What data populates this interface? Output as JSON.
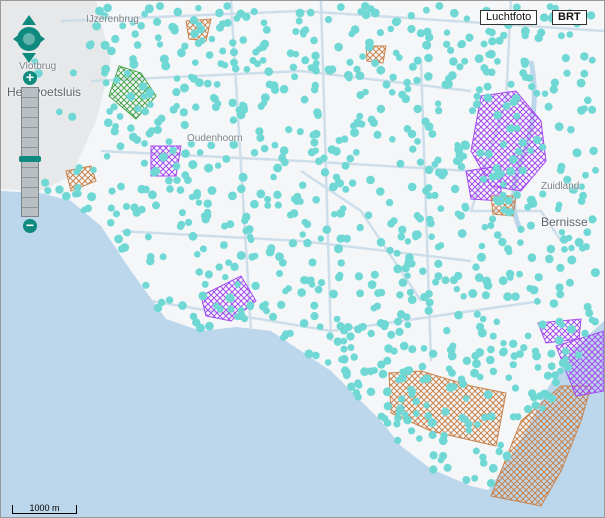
{
  "layers": {
    "aerial_label": "Luchtfoto",
    "topo_label": "BRT",
    "active": "BRT"
  },
  "scale_label": "1000 m",
  "places": {
    "hellevoetsluis": "Hellevoetsluis",
    "vlotbrug": "Vlotbrug",
    "ijzerenbrug": "IJzerenbrug",
    "oudenhoorn": "Oudenhoorn",
    "zuidland": "Zuidland",
    "bernisse": "Bernisse"
  },
  "zoom": {
    "in": "+",
    "out": "−",
    "level_fraction": 0.55
  },
  "colors": {
    "tree": "#6fd8d4",
    "water": "#bcd6ec",
    "land": "#f4f6f8",
    "road": "#c9dce9",
    "purple_zone": "#a44cf0",
    "orange_zone": "#c9834c",
    "green_zone": "#4aa44e",
    "nav": "#0f8a7e"
  },
  "icons": {
    "pan": "pan-arrows-icon"
  }
}
